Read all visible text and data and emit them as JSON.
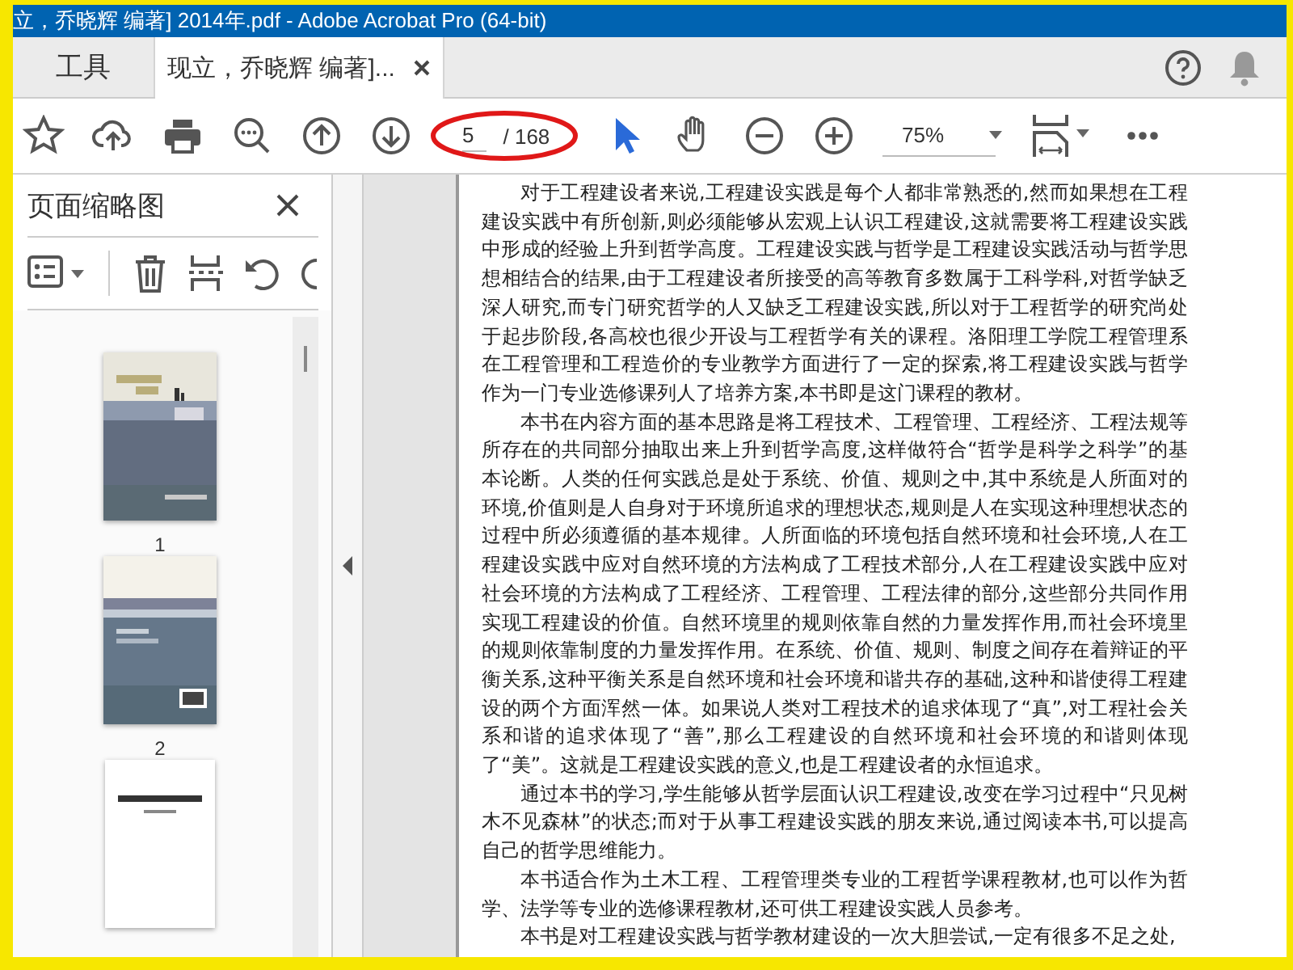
{
  "window": {
    "title": "立，乔晓辉 编著] 2014年.pdf - Adobe Acrobat Pro (64-bit)"
  },
  "tabs": [
    {
      "label": "工具",
      "selected": false,
      "closable": false
    },
    {
      "label": "现立，乔晓辉 编著]...",
      "selected": true,
      "closable": true
    }
  ],
  "toolbar": {
    "page_number": "5",
    "page_count": "/ 168",
    "page_field_circled": true,
    "zoom": "75%"
  },
  "sidebar": {
    "title": "页面缩略图",
    "thumbnails": [
      {
        "label": "1",
        "kind": "picture"
      },
      {
        "label": "2",
        "kind": "picture"
      },
      {
        "kind": "picture"
      }
    ]
  },
  "document": {
    "paragraphs": [
      "对于工程建设者来说,工程建设实践是每个人都非常熟悉的,然而如果想在工程建设实践中有所创新,则必须能够从宏观上认识工程建设,这就需要将工程建设实践中形成的经验上升到哲学高度。工程建设实践与哲学是工程建设实践活动与哲学思想相结合的结果,由于工程建设者所接受的高等教育多数属于工科学科,对哲学缺乏深人研究,而专门研究哲学的人又缺乏工程建设实践,所以对于工程哲学的研究尚处于起步阶段,各高校也很少开设与工程哲学有关的课程。洛阳理工学院工程管理系在工程管理和工程造价的专业教学方面进行了一定的探索,将工程建设实践与哲学作为一门专业选修课列人了培养方案,本书即是这门课程的教材。",
      "本书在内容方面的基本思路是将工程技术、工程管理、工程经济、工程法规等所存在的共同部分抽取出来上升到哲学高度,这样做符合“哲学是科学之科学”的基本论断。人类的任何实践总是处于系统、价值、规则之中,其中系统是人所面对的环境,价值则是人自身对于环境所追求的理想状态,规则是人在实现这种理想状态的过程中所必须遵循的基本规律。人所面临的环境包括自然环境和社会环境,人在工程建设实践中应对自然环境的方法构成了工程技术部分,人在工程建设实践中应对社会环境的方法构成了工程经济、工程管理、工程法律的部分,这些部分共同作用实现工程建设的价值。自然环境里的规则依靠自然的力量发挥作用,而社会环境里的规则依靠制度的力量发挥作用。在系统、价值、规则、制度之间存在着辩证的平衡关系,这种平衡关系是自然环境和社会环境和谐共存的基础,这种和谐使得工程建设的两个方面浑然一体。如果说人类对工程技术的追求体现了“真”,对工程社会关系和谐的追求体现了“善”,那么工程建设的自然环境和社会环境的和谐则体现了“美”。这就是工程建设实践的意义,也是工程建设者的永恒追求。",
      "通过本书的学习,学生能够从哲学层面认识工程建设,改变在学习过程中“只见树木不见森林”的状态;而对于从事工程建设实践的朋友来说,通过阅读本书,可以提高自己的哲学思维能力。",
      "本书适合作为土木工程、工程管理类专业的工程哲学课程教材,也可以作为哲学、法学等专业的选修课程教材,还可供工程建设实践人员参考。",
      "本书是对工程建设实践与哲学教材建设的一次大胆尝试,一定有很多不足之处,"
    ]
  }
}
